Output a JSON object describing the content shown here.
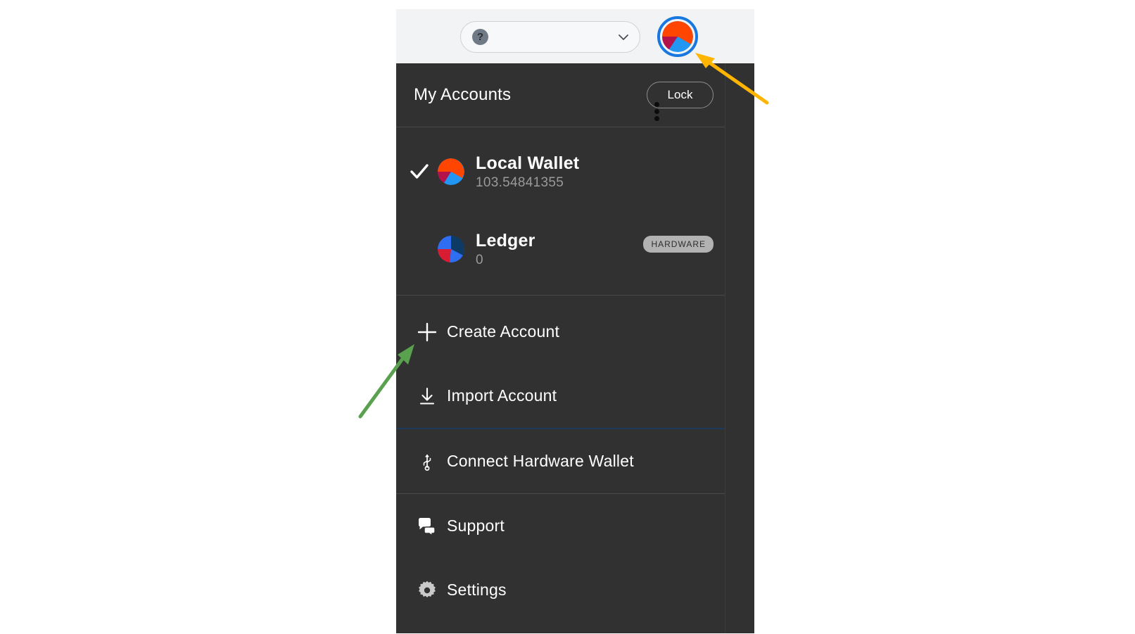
{
  "header": {
    "network_select": {
      "value": "",
      "placeholder": "",
      "help_icon": "question-mark-icon",
      "chevron_icon": "chevron-down-icon"
    },
    "avatar": {
      "name": "account-avatar",
      "highlight_color": "#1878e0",
      "colors": [
        "#ff4500",
        "#2196f3",
        "#b3124b"
      ]
    }
  },
  "panel": {
    "title": "My Accounts",
    "lock_label": "Lock",
    "kebab_icon": "more-vertical-icon",
    "accounts": [
      {
        "name": "Local Wallet",
        "balance": "103.54841355",
        "selected": true,
        "badge": "",
        "avatar_colors": [
          "#ff4500",
          "#2196f3",
          "#b3124b"
        ]
      },
      {
        "name": "Ledger",
        "balance": "0",
        "selected": false,
        "badge": "HARDWARE",
        "avatar_colors": [
          "#0d3b66",
          "#2f6ef0",
          "#d81d33"
        ]
      }
    ],
    "menu": [
      {
        "label": "Create Account",
        "icon": "plus-icon"
      },
      {
        "label": "Import Account",
        "icon": "download-icon"
      },
      {
        "label": "Connect Hardware Wallet",
        "icon": "usb-icon"
      },
      {
        "label": "Support",
        "icon": "chat-bubble-icon"
      },
      {
        "label": "Settings",
        "icon": "gear-icon"
      }
    ]
  },
  "annotations": {
    "avatar_arrow_color": "#ffb400",
    "create_account_arrow_color": "#59a14f"
  }
}
